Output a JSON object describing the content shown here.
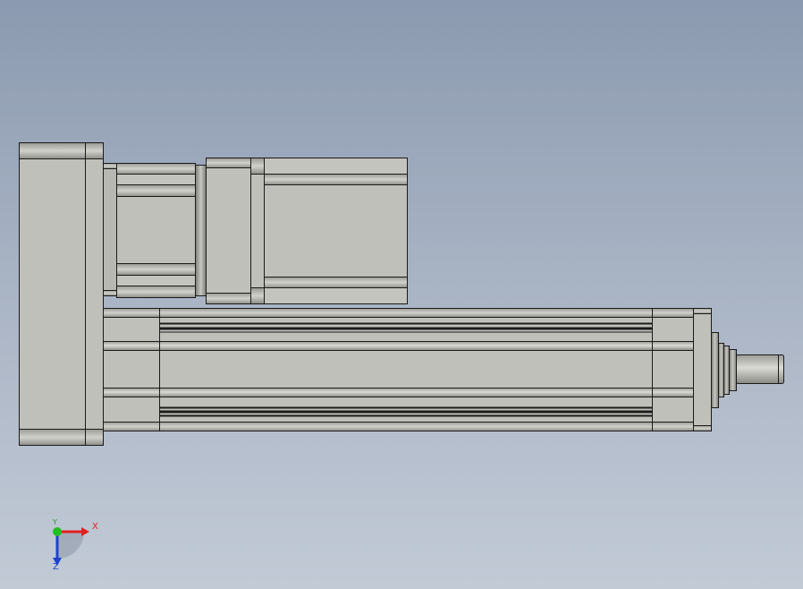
{
  "viewport": {
    "background_top": "#8b9ab0",
    "background_bottom": "#c2cad6"
  },
  "model": {
    "body_color": "#c0c0ba",
    "edge_color": "#1a1a1a"
  },
  "triad": {
    "x_label": "X",
    "y_label": "Y",
    "z_label": "Z",
    "x_color": "#e02020",
    "y_color": "#20c020",
    "z_color": "#2040d0"
  }
}
